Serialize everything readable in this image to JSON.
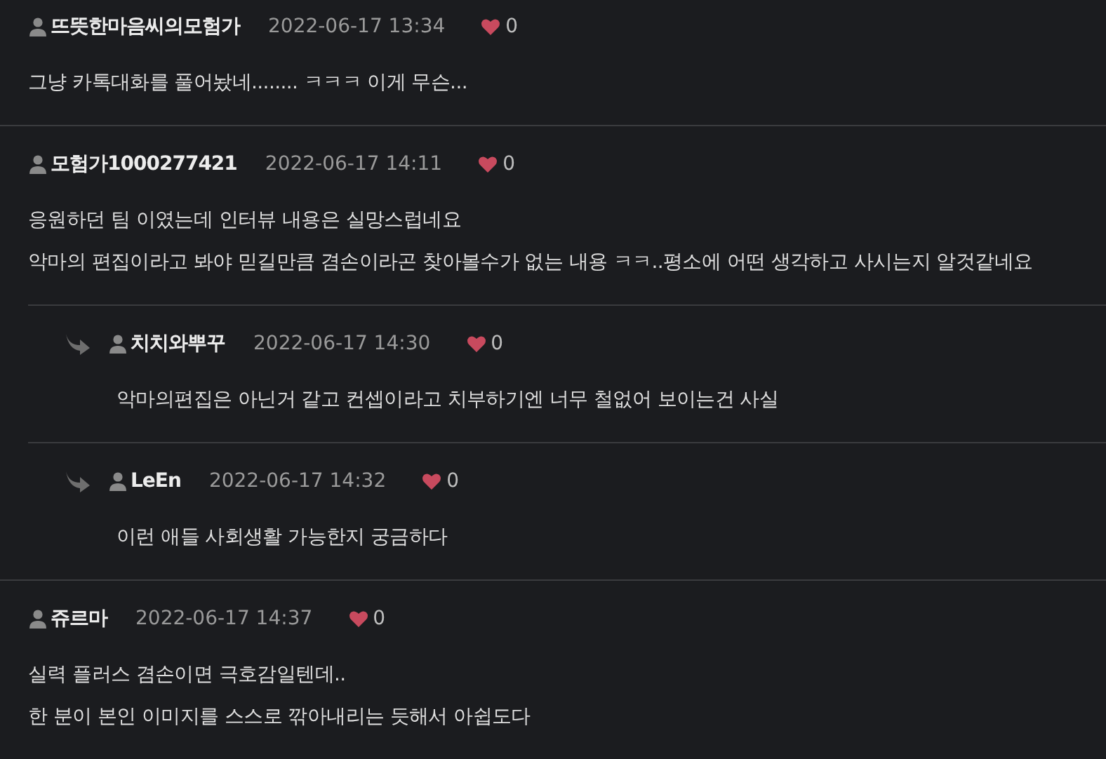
{
  "comments": [
    {
      "author": "뜨뜻한마음씨의모험가",
      "date": "2022-06-17 13:34",
      "likes": "0",
      "lines": [
        "그냥 카톡대화를 풀어놨네........ ㅋㅋㅋ 이게 무슨..."
      ]
    },
    {
      "author": "모험가1000277421",
      "date": "2022-06-17 14:11",
      "likes": "0",
      "lines": [
        "응원하던 팀 이였는데 인터뷰 내용은 실망스럽네요",
        "악마의 편집이라고 봐야 믿길만큼 겸손이라곤 찾아볼수가 없는 내용 ㅋㅋ..평소에 어떤 생각하고 사시는지 알것같네요"
      ],
      "children": [
        {
          "author": "치치와뿌꾸",
          "date": "2022-06-17 14:30",
          "likes": "0",
          "lines": [
            "악마의편집은 아닌거 같고 컨셉이라고 치부하기엔 너무 철없어 보이는건 사실"
          ]
        },
        {
          "author": "LeEn",
          "date": "2022-06-17 14:32",
          "likes": "0",
          "lines": [
            "이런 애들 사회생활 가능한지 궁금하다"
          ]
        }
      ]
    },
    {
      "author": "쥬르마",
      "date": "2022-06-17 14:37",
      "likes": "0",
      "lines": [
        "실력 플러스 겸손이면 극호감일텐데..",
        "한 분이 본인 이미지를 스스로 깎아내리는 듯해서 아쉽도다"
      ]
    }
  ]
}
